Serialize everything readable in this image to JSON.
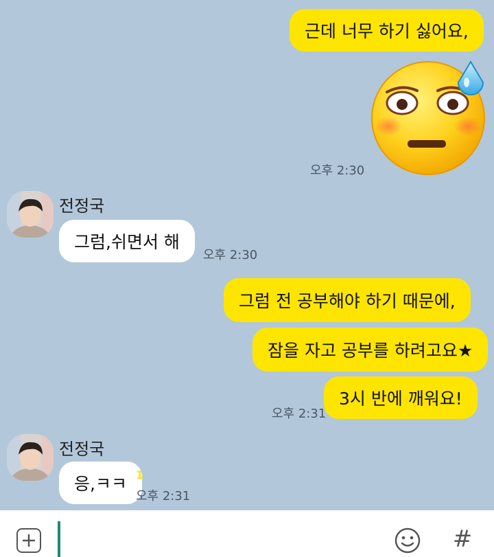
{
  "chat": {
    "messages": [
      {
        "text": "근데 너무 하기 싫어요,"
      },
      {
        "sticker": "worried-sweat-emoji",
        "time": "오후 2:30"
      },
      {
        "sender": "전정국",
        "text": "그럼,쉬면서 해",
        "time": "오후 2:30"
      },
      {
        "text": "그럼 전 공부해야 하기 때문에,"
      },
      {
        "text": "잠을 자고 공부를  하려고요★"
      },
      {
        "text": "3시 반에 깨워요!",
        "time": "오후 2:31"
      },
      {
        "sender": "전정국",
        "text": "응,ㅋㅋ",
        "unread": "1",
        "time": "오후 2:31"
      }
    ]
  },
  "input_bar": {
    "plus_icon": "plus-box-icon",
    "emoji_icon": "smiley-icon",
    "hash_label": "#"
  },
  "colors": {
    "background": "#b2c7da",
    "my_bubble": "#fee500",
    "their_bubble": "#ffffff",
    "caret": "#1e8a78"
  }
}
